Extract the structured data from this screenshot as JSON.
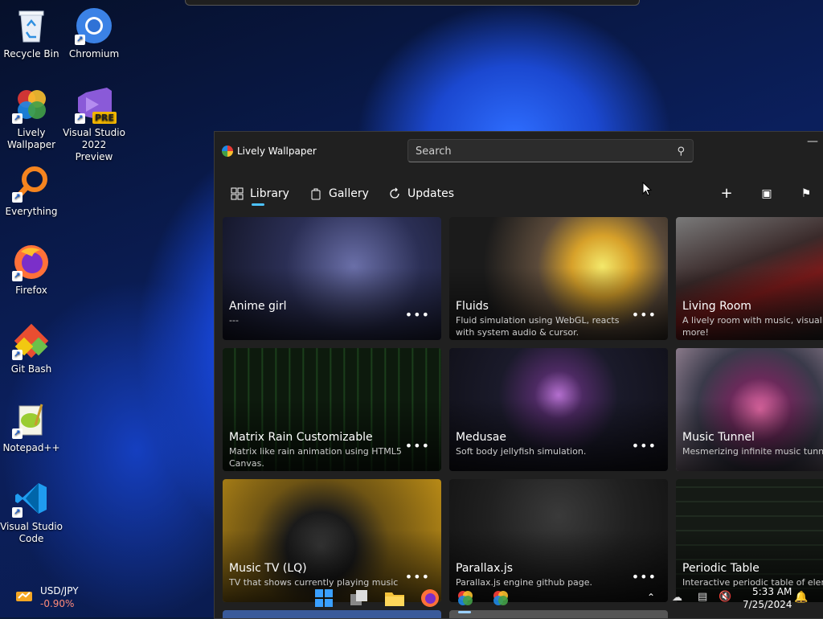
{
  "desktop": {
    "icons": [
      {
        "label": "Recycle Bin"
      },
      {
        "label": "Chromium"
      },
      {
        "label": "Lively Wallpaper"
      },
      {
        "label": "Visual Studio 2022 Preview",
        "badge": "PRE"
      },
      {
        "label": "Everything"
      },
      {
        "label": "Firefox"
      },
      {
        "label": "Git Bash"
      },
      {
        "label": "Notepad++"
      },
      {
        "label": "Visual Studio Code"
      }
    ]
  },
  "window": {
    "title": "Lively Wallpaper",
    "search_placeholder": "Search",
    "nav": {
      "library": "Library",
      "gallery": "Gallery",
      "updates": "Updates"
    },
    "accent": "#4cc2ff",
    "cards": [
      {
        "title": "Anime girl",
        "desc": "---"
      },
      {
        "title": "Fluids",
        "desc": "Fluid simulation using WebGL, reacts with system audio & cursor."
      },
      {
        "title": "Living Room",
        "desc": "A lively room with music, visualize more!"
      },
      {
        "title": "Matrix Rain Customizable",
        "desc": "Matrix like rain animation using HTML5 Canvas."
      },
      {
        "title": "Medusae",
        "desc": "Soft body jellyfish simulation."
      },
      {
        "title": "Music Tunnel",
        "desc": "Mesmerizing infinite music tunne"
      },
      {
        "title": "Music TV (LQ)",
        "desc": "TV that shows currently playing music"
      },
      {
        "title": "Parallax.js",
        "desc": "Parallax.js engine github page."
      },
      {
        "title": "Periodic Table",
        "desc": "Interactive periodic table of elem"
      }
    ]
  },
  "taskbar": {
    "widget_title": "USD/JPY",
    "widget_value": "-0.90%",
    "clock_time": "5:33 AM",
    "clock_date": "7/25/2024"
  }
}
